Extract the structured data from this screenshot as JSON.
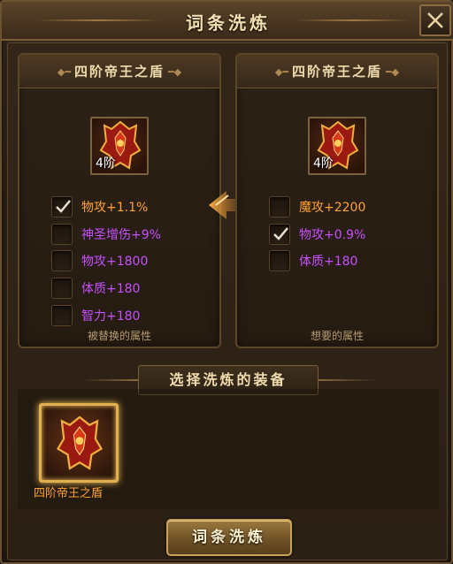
{
  "window": {
    "title": "词条洗炼"
  },
  "icons": {
    "close": "close-icon",
    "check": "check-icon",
    "arrow": "arrow-left-icon",
    "equipment": "shield-icon"
  },
  "left_panel": {
    "title": "四阶帝王之盾",
    "tier": "4阶",
    "attributes": [
      {
        "label": "物攻+1.1%",
        "color": "#ffa234",
        "checked": true
      },
      {
        "label": "神圣增伤+9%",
        "color": "#c650ff",
        "checked": false
      },
      {
        "label": "物攻+1800",
        "color": "#c650ff",
        "checked": false
      },
      {
        "label": "体质+180",
        "color": "#c650ff",
        "checked": false
      },
      {
        "label": "智力+180",
        "color": "#c650ff",
        "checked": false
      }
    ],
    "footer": "被替换的属性"
  },
  "right_panel": {
    "title": "四阶帝王之盾",
    "tier": "4阶",
    "attributes": [
      {
        "label": "魔攻+2200",
        "color": "#ffa234",
        "checked": false
      },
      {
        "label": "物攻+0.9%",
        "color": "#c650ff",
        "checked": true
      },
      {
        "label": "体质+180",
        "color": "#c650ff",
        "checked": false
      }
    ],
    "footer": "想要的属性"
  },
  "selection": {
    "title": "选择洗炼的装备",
    "items": [
      {
        "name": "四阶帝王之盾",
        "selected": true
      }
    ]
  },
  "action_button": {
    "label": "词条洗炼"
  },
  "colors": {
    "orange": "#ffa234",
    "purple": "#c650ff",
    "gold_border": "#e0b050"
  }
}
